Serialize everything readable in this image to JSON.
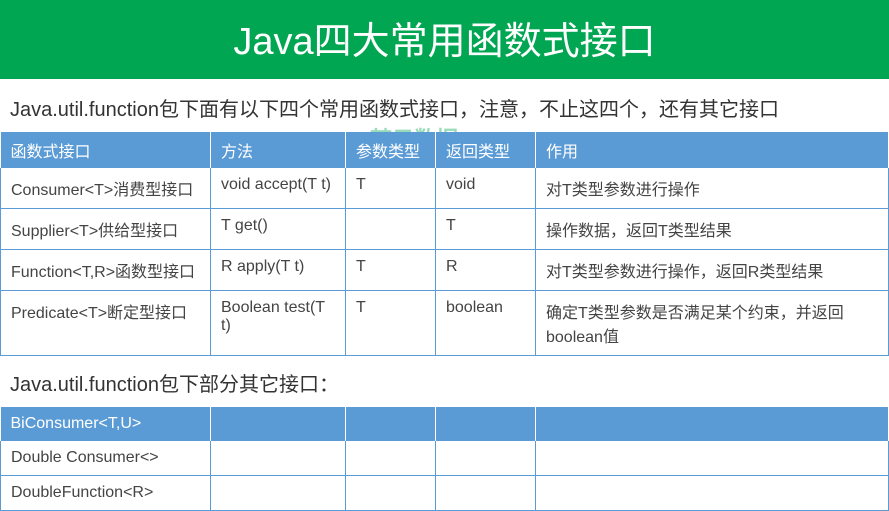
{
  "title": "Java四大常用函数式接口",
  "subtitle": "Java.util.function包下面有以下四个常用函数式接口，注意，不止这四个，还有其它接口",
  "watermark": "梦云数据",
  "table1": {
    "headers": [
      "函数式接口",
      "方法",
      "参数类型",
      "返回类型",
      "作用"
    ],
    "rows": [
      [
        "Consumer<T>消费型接口",
        "void accept(T t)",
        "T",
        "void",
        "对T类型参数进行操作"
      ],
      [
        "Supplier<T>供给型接口",
        "T get()",
        "",
        "T",
        "操作数据，返回T类型结果"
      ],
      [
        "Function<T,R>函数型接口",
        "R apply(T t)",
        "T",
        "R",
        "对T类型参数进行操作，返回R类型结果"
      ],
      [
        "Predicate<T>断定型接口",
        "Boolean test(T t)",
        "T",
        "boolean",
        "确定T类型参数是否满足某个约束，并返回boolean值"
      ]
    ]
  },
  "subtitle2": "Java.util.function包下部分其它接口：",
  "table2": {
    "headers": [
      "BiConsumer<T,U>",
      "",
      "",
      "",
      ""
    ],
    "rows": [
      [
        "Double Consumer<>",
        "",
        "",
        "",
        ""
      ],
      [
        "DoubleFunction<R>",
        "",
        "",
        "",
        ""
      ]
    ]
  }
}
